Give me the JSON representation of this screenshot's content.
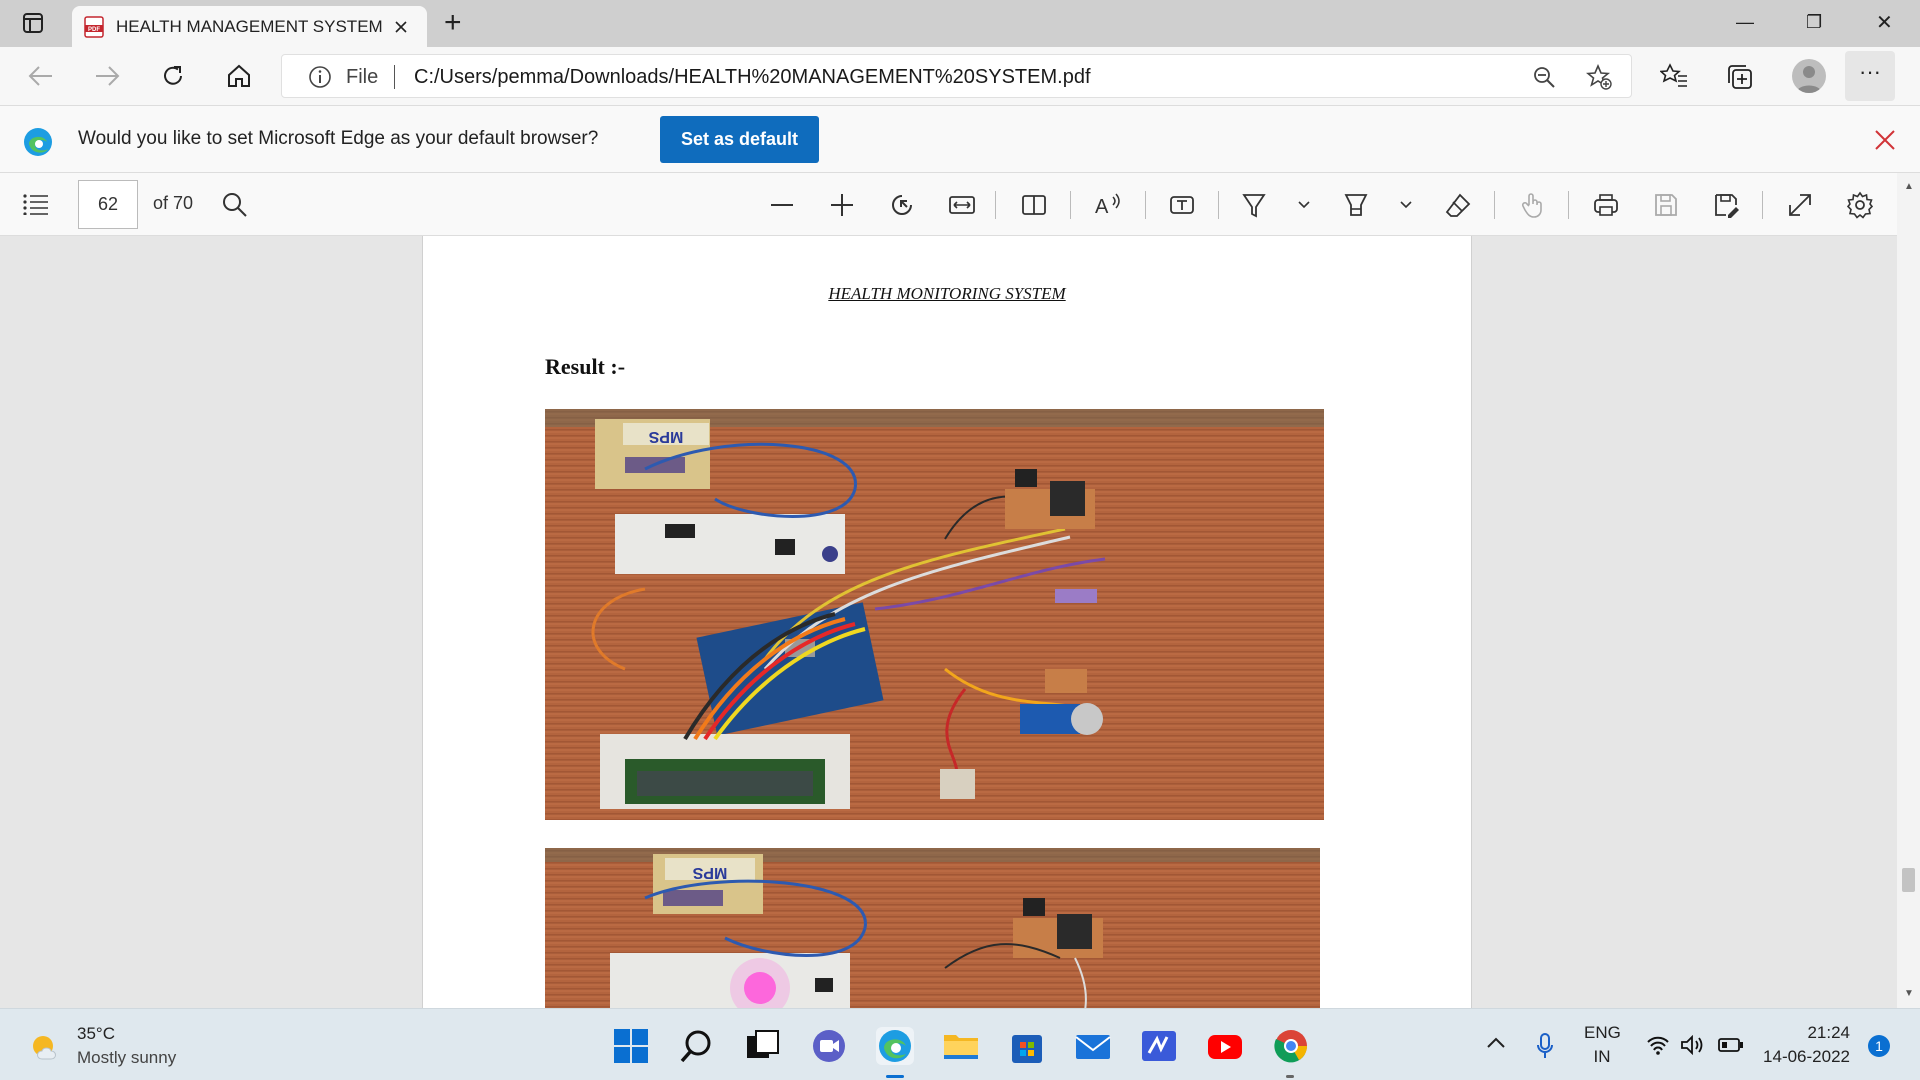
{
  "tab": {
    "title": "HEALTH MANAGEMENT SYSTEM",
    "new_tab": "+"
  },
  "window": {
    "minimize": "—",
    "restore": "❐",
    "close": "✕"
  },
  "address": {
    "scheme": "File",
    "url": "C:/Users/pemma/Downloads/HEALTH%20MANAGEMENT%20SYSTEM.pdf"
  },
  "infobar": {
    "message": "Would you like to set Microsoft Edge as your default browser?",
    "button": "Set as default"
  },
  "pdf_toolbar": {
    "page_current": "62",
    "page_total": "of 70"
  },
  "document": {
    "header": "HEALTH MONITORING SYSTEM",
    "heading": "Result :-",
    "module_label": "MPS"
  },
  "taskbar": {
    "weather_temp": "35°C",
    "weather_desc": "Mostly sunny",
    "lang_top": "ENG",
    "lang_bottom": "IN",
    "time": "21:24",
    "date": "14-06-2022",
    "notifications": "1"
  },
  "colors": {
    "accent": "#0f6cbd",
    "close_red": "#d13438",
    "wood": "#b3643e"
  }
}
